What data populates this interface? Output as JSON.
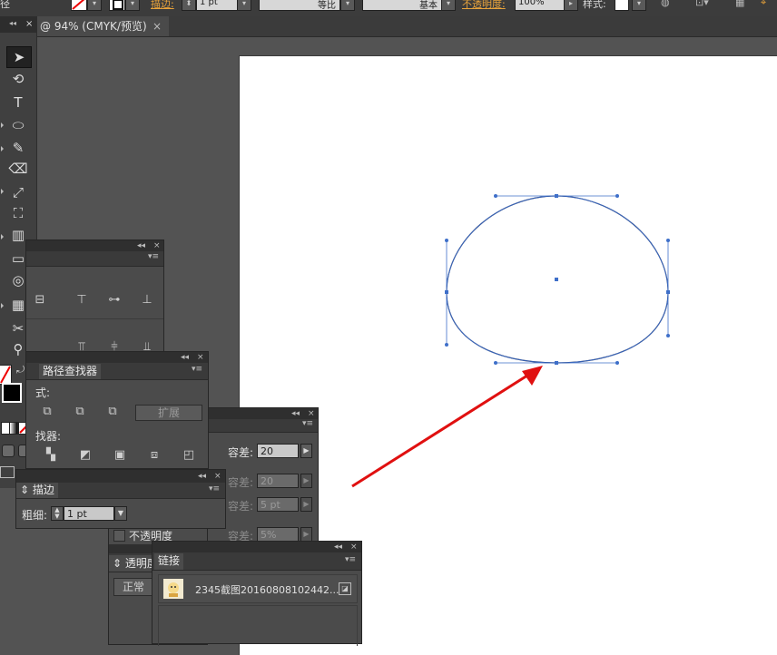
{
  "control_bar": {
    "stroke_label": "描边:",
    "stroke_weight": "1 pt",
    "profile": "等比",
    "brush": "基本",
    "opacity_label": "不透明度:",
    "opacity_value": "100%",
    "style_label": "样式:",
    "prefix": "径"
  },
  "document_tab": {
    "title": "@ 94% (CMYK/预览)",
    "close": "×"
  },
  "tools_panel": {
    "close": "×",
    "collapse": "◂◂"
  },
  "align_panel": {
    "collapse": "◂◂",
    "close": "×",
    "menu": "▾≡"
  },
  "pathfinder_panel": {
    "collapse": "◂◂",
    "close": "×",
    "menu": "▾≡",
    "tab": "路径查找器",
    "shape_modes_label": "式:",
    "expand_button": "扩展",
    "pathfinders_label": "找器:"
  },
  "magic_panel": {
    "collapse": "◂◂",
    "close": "×",
    "menu": "▾≡",
    "tolerance_label": "容差:",
    "rows": [
      {
        "value": "20",
        "enabled": true
      },
      {
        "value": "20",
        "enabled": false
      },
      {
        "value": "5 pt",
        "enabled": false
      },
      {
        "value": "5%",
        "enabled": false
      }
    ],
    "opacity_check_label": "不透明度"
  },
  "stroke_panel": {
    "collapse": "◂◂",
    "close": "×",
    "menu": "▾≡",
    "tab": "描边",
    "weight_label": "粗细:",
    "weight_value": "1 pt"
  },
  "transparency_panel": {
    "tab": "透明度",
    "blend_mode": "正常"
  },
  "links_panel": {
    "collapse": "◂◂",
    "close": "×",
    "menu": "▾≡",
    "tab": "链接",
    "items": [
      {
        "name": "2345截图20160808102442..."
      }
    ]
  },
  "colors": {
    "selection_blue": "#3e6fc9",
    "annotation_red": "#e01010",
    "artboard": "#ffffff",
    "workspace": "#535353"
  }
}
